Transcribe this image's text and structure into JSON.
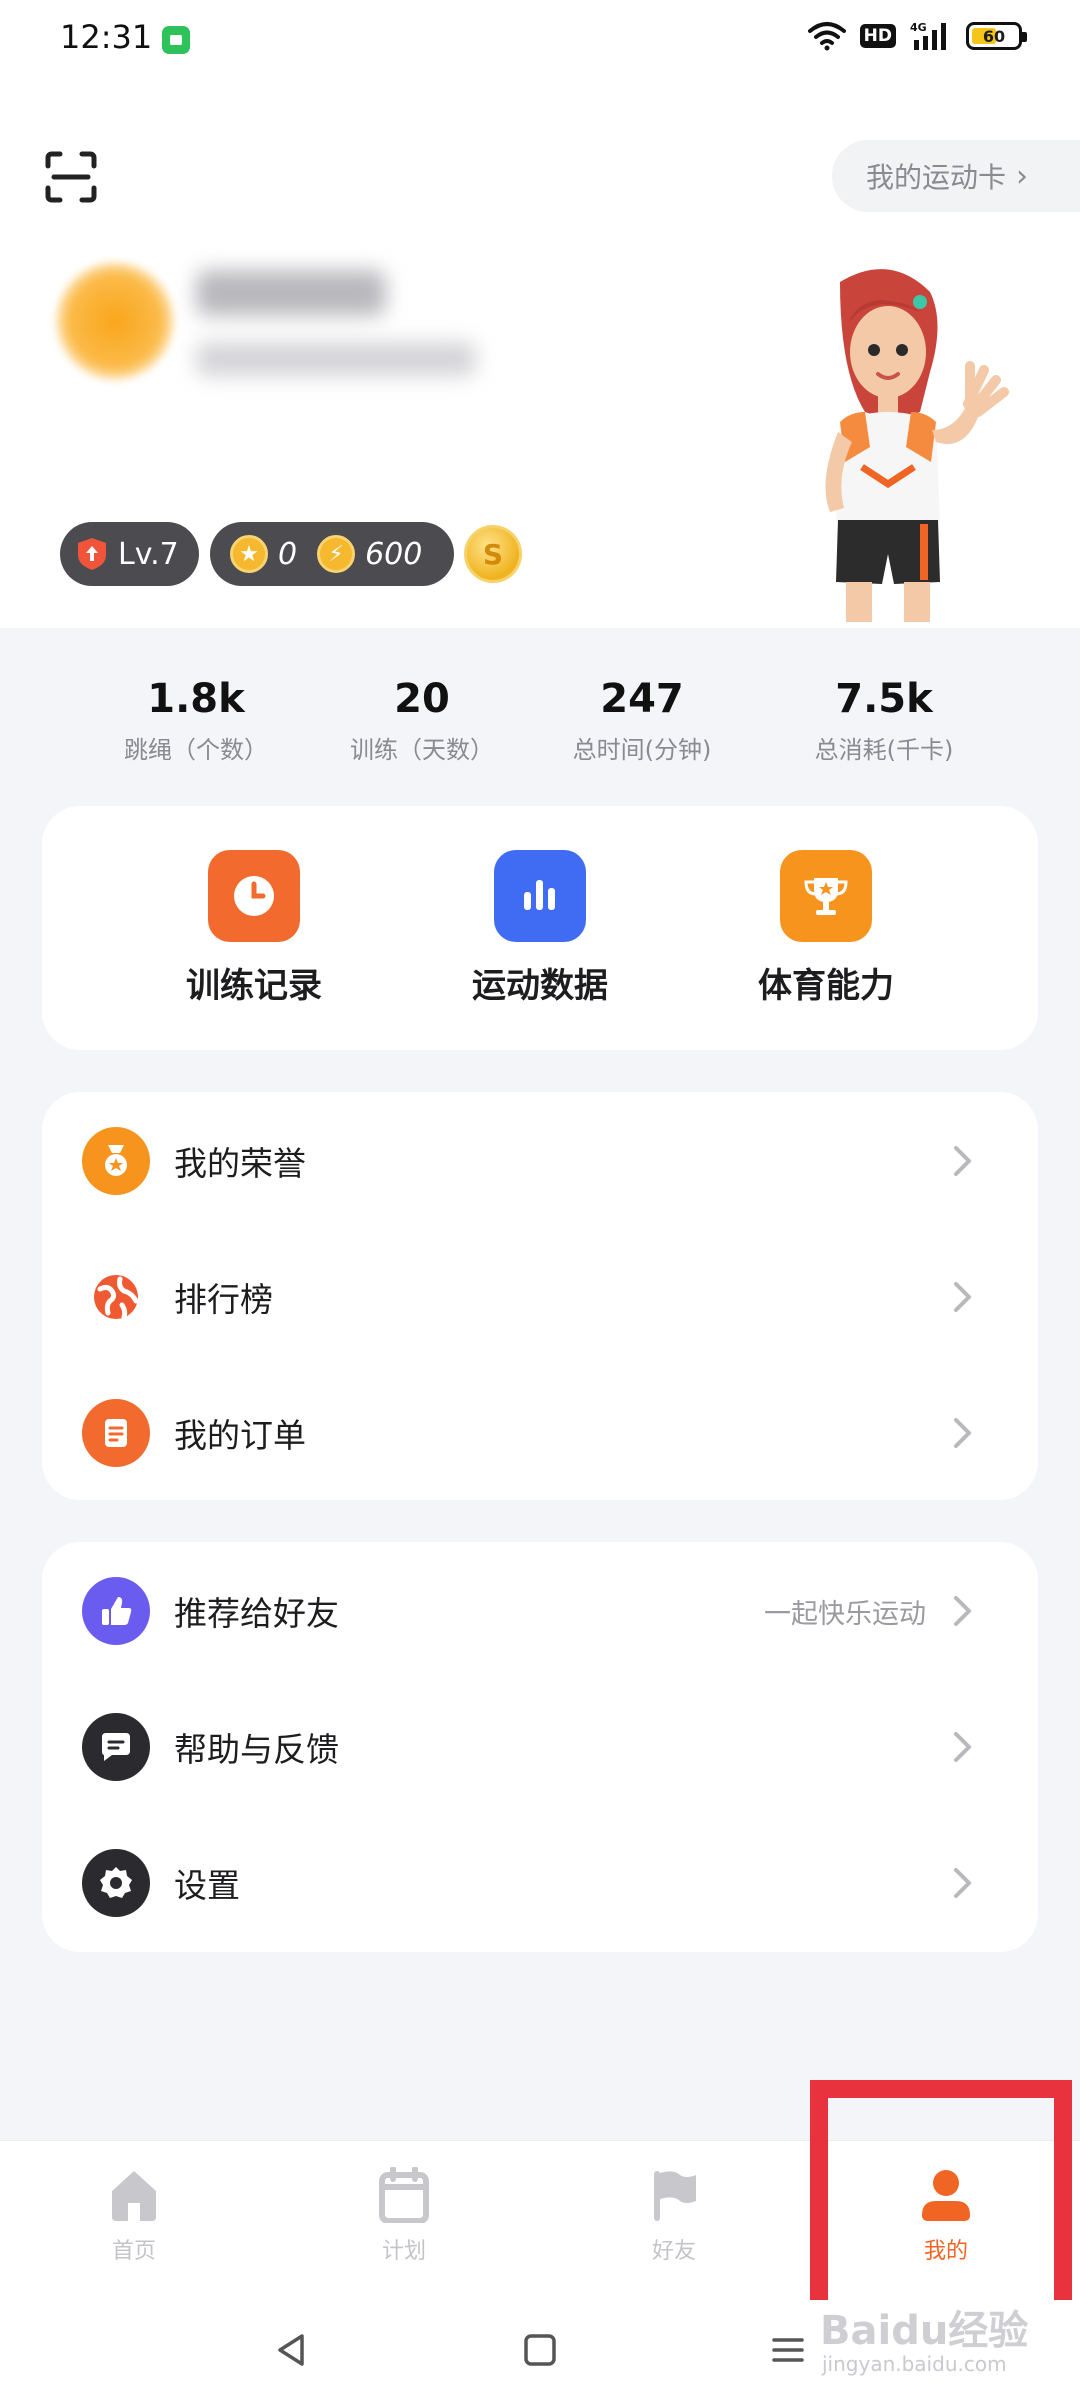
{
  "status_bar": {
    "time": "12:31",
    "network": "4G",
    "hd": "HD",
    "battery": "60"
  },
  "header": {
    "sport_card_label": "我的运动卡"
  },
  "badges": {
    "level": "Lv.7",
    "coins": "0",
    "energy": "600"
  },
  "stats": [
    {
      "value": "1.8k",
      "label": "跳绳（个数）"
    },
    {
      "value": "20",
      "label": "训练（天数）"
    },
    {
      "value": "247",
      "label": "总时间(分钟)"
    },
    {
      "value": "7.5k",
      "label": "总消耗(千卡)"
    }
  ],
  "quick_actions": [
    {
      "label": "训练记录",
      "icon": "clock-icon",
      "color": "#f26a2e"
    },
    {
      "label": "运动数据",
      "icon": "bar-chart-icon",
      "color": "#3f6cf3"
    },
    {
      "label": "体育能力",
      "icon": "trophy-icon",
      "color": "#f7941d"
    }
  ],
  "menu_group_1": [
    {
      "label": "我的荣誉",
      "icon": "medal-icon",
      "color": "#f7941d"
    },
    {
      "label": "排行榜",
      "icon": "globe-icon",
      "color": "#ef5a32"
    },
    {
      "label": "我的订单",
      "icon": "order-icon",
      "color": "#f26a2e"
    }
  ],
  "menu_group_2": [
    {
      "label": "推荐给好友",
      "hint": "一起快乐运动",
      "icon": "thumbs-up-icon",
      "color": "#6b5cf0"
    },
    {
      "label": "帮助与反馈",
      "icon": "chat-icon",
      "color": "#2b2b2f"
    },
    {
      "label": "设置",
      "icon": "gear-icon",
      "color": "#2b2b2f"
    }
  ],
  "tabs": [
    {
      "label": "首页",
      "icon": "home-icon"
    },
    {
      "label": "计划",
      "icon": "calendar-icon"
    },
    {
      "label": "好友",
      "icon": "flag-icon"
    },
    {
      "label": "我的",
      "icon": "person-icon",
      "active": true
    }
  ],
  "colors": {
    "accent": "#f06524",
    "highlight": "#e8333f",
    "background": "#f4f5f9"
  },
  "watermark": {
    "text": "Baidu经验",
    "sub": "jingyan.baidu.com"
  }
}
